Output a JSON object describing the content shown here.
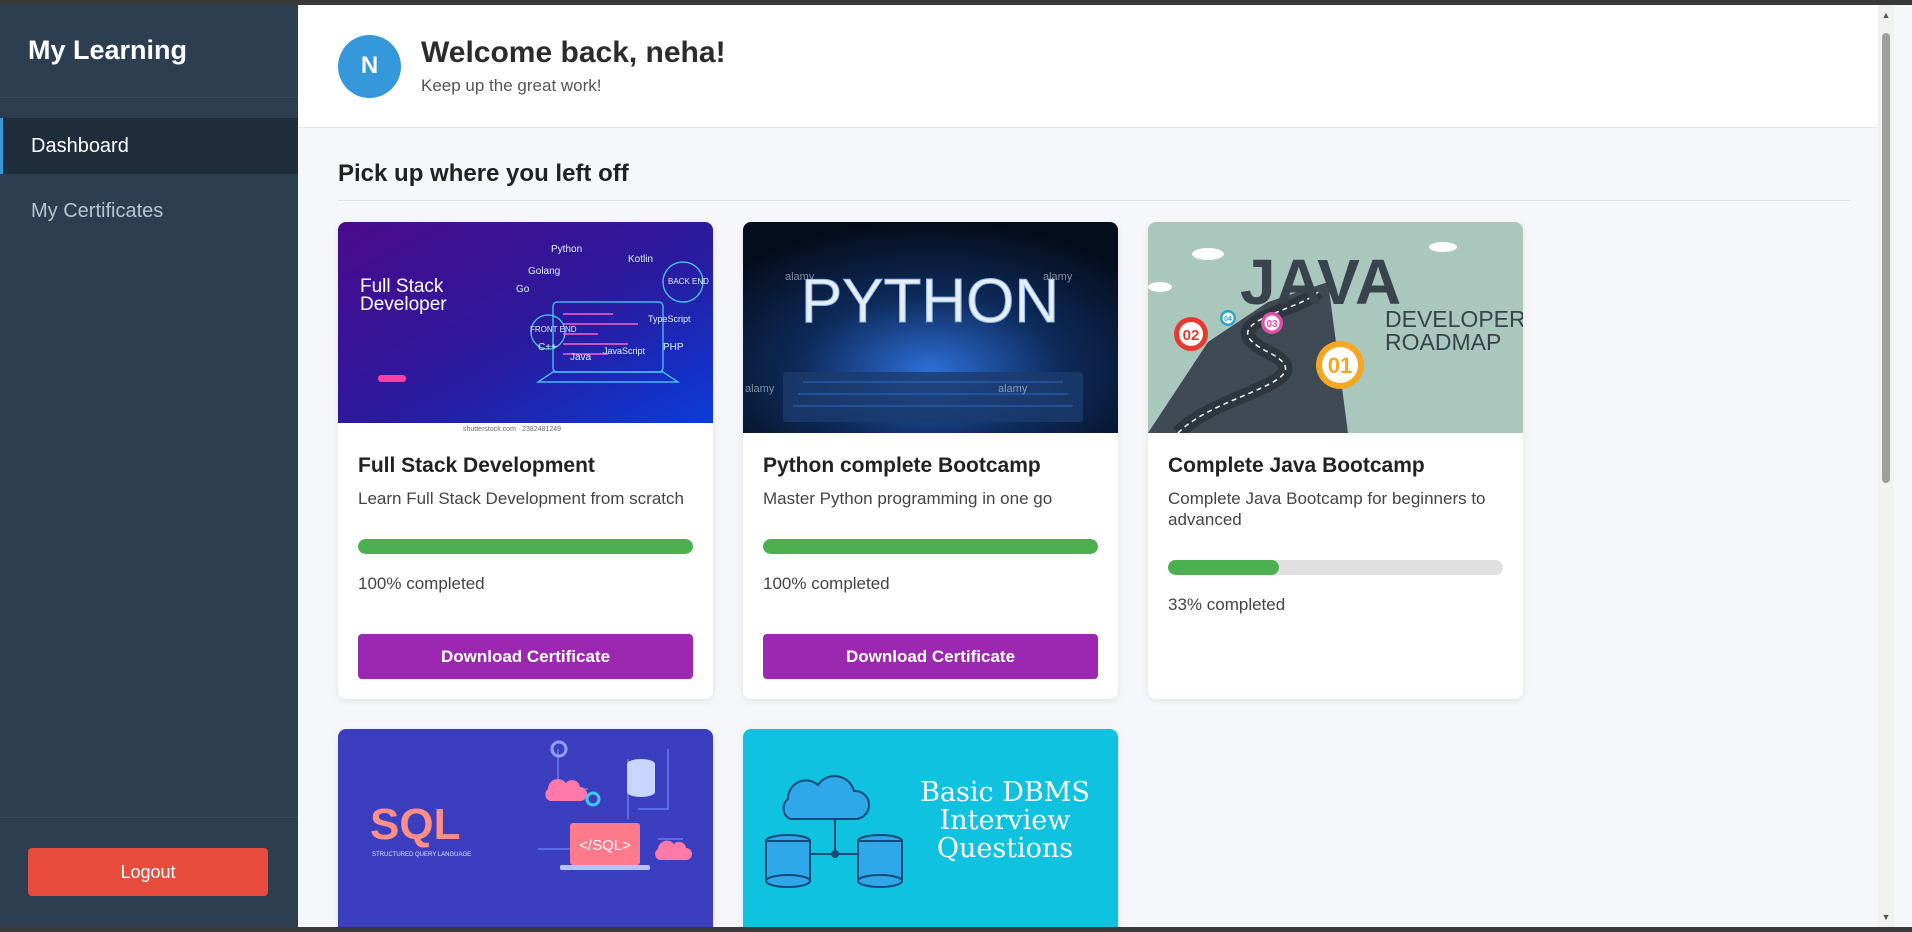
{
  "sidebar": {
    "brand": "My Learning",
    "items": [
      {
        "label": "Dashboard",
        "active": true
      },
      {
        "label": "My Certificates",
        "active": false
      }
    ],
    "logout_label": "Logout"
  },
  "header": {
    "avatar_initial": "N",
    "title": "Welcome back, neha!",
    "subtitle": "Keep up the great work!"
  },
  "main": {
    "section_title": "Pick up where you left off",
    "courses": [
      {
        "title": "Full Stack Development",
        "description": "Learn Full Stack Development from scratch",
        "progress": 100,
        "progress_text": "100% completed",
        "button_label": "Download Certificate",
        "image": {
          "heading_line1": "Full Stack",
          "heading_line2": "Developer",
          "tags": [
            "Python",
            "Golang",
            "Kotlin",
            "BACK END",
            "FRONT END",
            "TypeScript",
            "JavaScript",
            "Java",
            "PHP",
            "C++",
            "Go"
          ],
          "footer": "shutterstock.com · 2382481249"
        }
      },
      {
        "title": "Python complete Bootcamp",
        "description": "Master Python programming in one go",
        "progress": 100,
        "progress_text": "100% completed",
        "button_label": "Download Certificate",
        "image": {
          "text": "PYTHON",
          "watermark": "alamy"
        }
      },
      {
        "title": "Complete Java Bootcamp",
        "description": "Complete Java Bootcamp for beginners to advanced",
        "progress": 33,
        "progress_text": "33% completed",
        "button_label": "",
        "image": {
          "logo": "JAVA",
          "line1": "DEVELOPER",
          "line2": "ROADMAP",
          "pins": [
            "02",
            "04",
            "03",
            "01"
          ]
        }
      },
      {
        "title": "",
        "description": "",
        "image": {
          "text": "SQL",
          "subtext": "STRUCTURED QUERY LANGUAGE",
          "tag": "</SQL>"
        }
      },
      {
        "title": "",
        "description": "",
        "image": {
          "line1": "Basic DBMS",
          "line2": "Interview",
          "line3": "Questions"
        }
      }
    ]
  },
  "colors": {
    "sidebar_bg": "#2c3e50",
    "accent_blue": "#3498db",
    "progress_green": "#4caf50",
    "certificate_purple": "#9c27b0",
    "logout_red": "#e74c3c"
  }
}
